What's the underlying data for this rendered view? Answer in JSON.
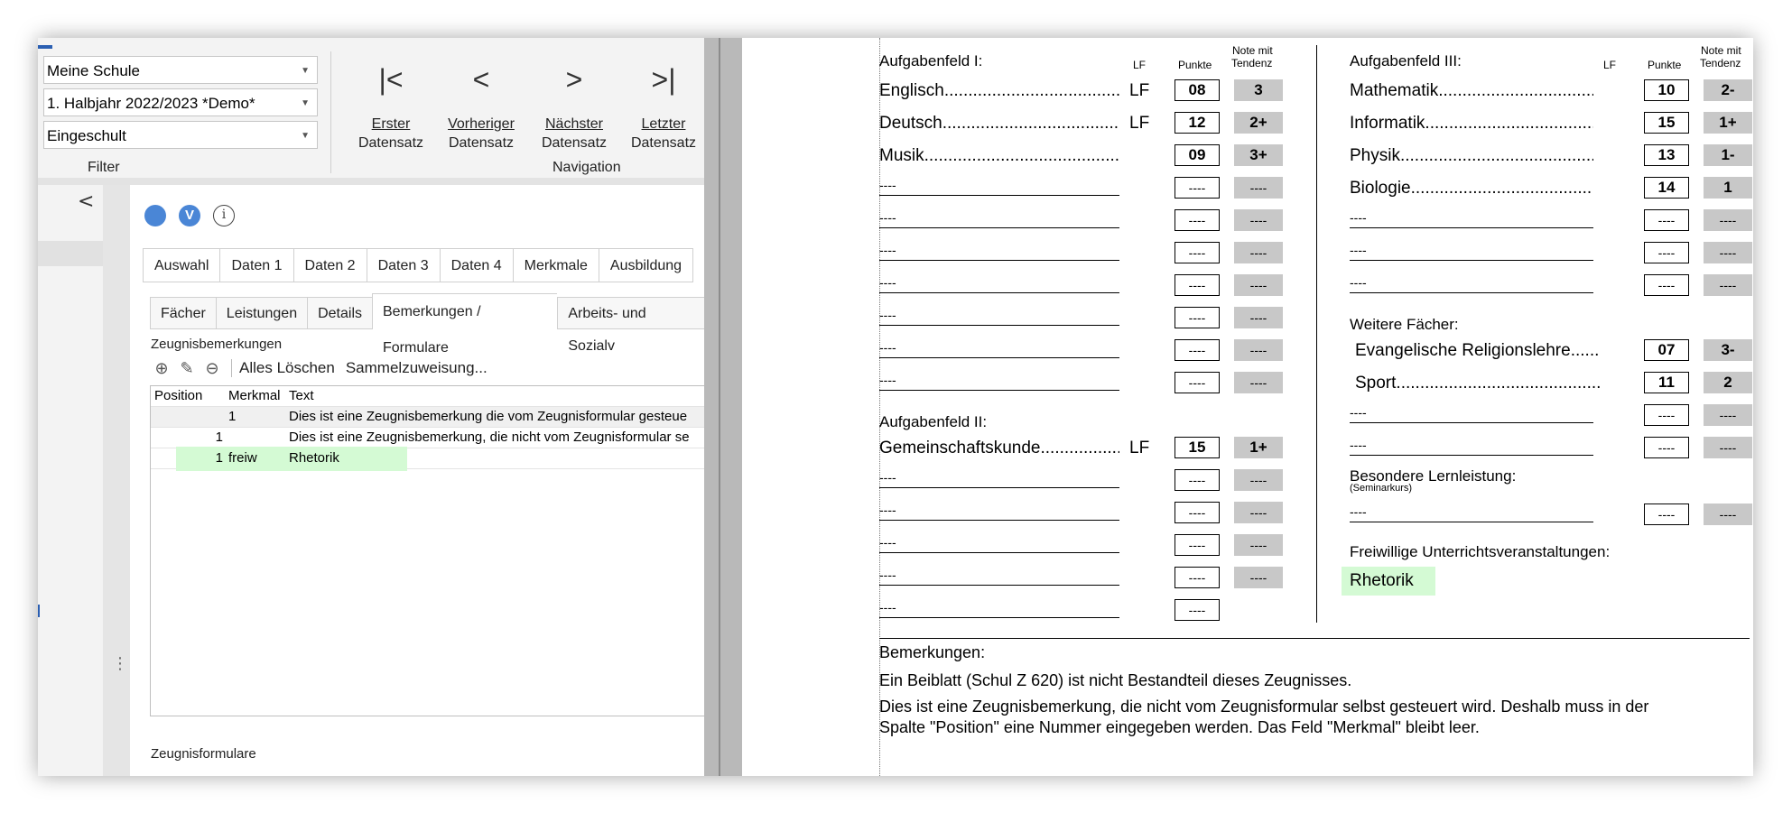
{
  "filter": {
    "school": "Meine Schule",
    "term": "1. Halbjahr 2022/2023 *Demo*",
    "status": "Eingeschult",
    "label": "Filter"
  },
  "navigation": {
    "label": "Navigation",
    "first": {
      "glyph": "|<",
      "line1": "Erster",
      "line2": "Datensatz"
    },
    "prev": {
      "glyph": "<",
      "line1": "Vorheriger",
      "line2": "Datensatz"
    },
    "next": {
      "glyph": ">",
      "line1": "Nächster",
      "line2": "Datensatz"
    },
    "last": {
      "glyph": ">|",
      "line1": "Letzter",
      "line2": "Datensatz"
    }
  },
  "sidebar": {
    "collapse": "<"
  },
  "status_icons": {
    "v_letter": "V",
    "info": "i"
  },
  "tabs_main": [
    "Auswahl",
    "Daten 1",
    "Daten 2",
    "Daten 3",
    "Daten 4",
    "Merkmale",
    "Ausbildung"
  ],
  "tabs_sub": [
    "Fächer",
    "Leistungen",
    "Details",
    "Bemerkungen / Formulare",
    "Arbeits- und Sozialv"
  ],
  "remarks_section": {
    "title": "Zeugnisbemerkungen",
    "delete_all": "Alles Löschen",
    "bulk_assign": "Sammelzuweisung...",
    "columns": [
      "Position",
      "Merkmal",
      "Text"
    ],
    "rows": [
      {
        "position": "",
        "merkmal": "1",
        "text": "Dies ist eine Zeugnisbemerkung die vom Zeugnisformular gesteue"
      },
      {
        "position": "1",
        "merkmal": "",
        "text": "Dies ist eine Zeugnisbemerkung, die nicht vom Zeugnisformular se"
      },
      {
        "position": "1",
        "merkmal": "freiw",
        "text": "Rhetorik"
      }
    ]
  },
  "forms_section": {
    "title": "Zeugnisformulare"
  },
  "report": {
    "col_lf": "LF",
    "col_points": "Punkte",
    "col_grade_l1": "Note mit",
    "col_grade_l2": "Tendenz",
    "field1": {
      "title": "Aufgabenfeld I:",
      "subjects": [
        {
          "name": "Englisch",
          "lf": "LF",
          "points": "08",
          "grade": "3"
        },
        {
          "name": "Deutsch",
          "lf": "LF",
          "points": "12",
          "grade": "2+"
        },
        {
          "name": "Musik",
          "lf": "",
          "points": "09",
          "grade": "3+"
        }
      ]
    },
    "field2": {
      "title": "Aufgabenfeld II:",
      "subjects": [
        {
          "name": "Gemeinschaftskunde",
          "lf": "LF",
          "points": "15",
          "grade": "1+"
        }
      ]
    },
    "field3": {
      "title": "Aufgabenfeld III:",
      "subjects": [
        {
          "name": "Mathematik",
          "points": "10",
          "grade": "2-"
        },
        {
          "name": "Informatik",
          "points": "15",
          "grade": "1+"
        },
        {
          "name": "Physik",
          "points": "13",
          "grade": "1-"
        },
        {
          "name": "Biologie",
          "points": "14",
          "grade": "1"
        }
      ]
    },
    "further": {
      "title": "Weitere Fächer:",
      "subjects": [
        {
          "name": "Evangelische Religionslehre",
          "points": "07",
          "grade": "3-"
        },
        {
          "name": "Sport",
          "points": "11",
          "grade": "2"
        }
      ]
    },
    "special": {
      "title": "Besondere Lernleistung:",
      "subtitle": "(Seminarkurs)"
    },
    "voluntary": {
      "title": "Freiwillige Unterrichtsveranstaltungen:",
      "value": "Rhetorik"
    },
    "empty_mark": "----",
    "remarks_title": "Bemerkungen:",
    "remarks_line1": "Ein Beiblatt (Schul Z 620) ist nicht Bestandteil dieses Zeugnisses.",
    "remarks_line2": "Dies ist eine Zeugnisbemerkung, die nicht vom Zeugnisformular selbst gesteuert wird. Deshalb muss in der",
    "remarks_line3": "Spalte \"Position\" eine Nummer eingegeben werden. Das Feld \"Merkmal\" bleibt leer."
  },
  "colors": {
    "highlight_green": "#d4fad4",
    "grade_gray": "#c8c8c8",
    "accent_blue": "#4a86d6"
  }
}
